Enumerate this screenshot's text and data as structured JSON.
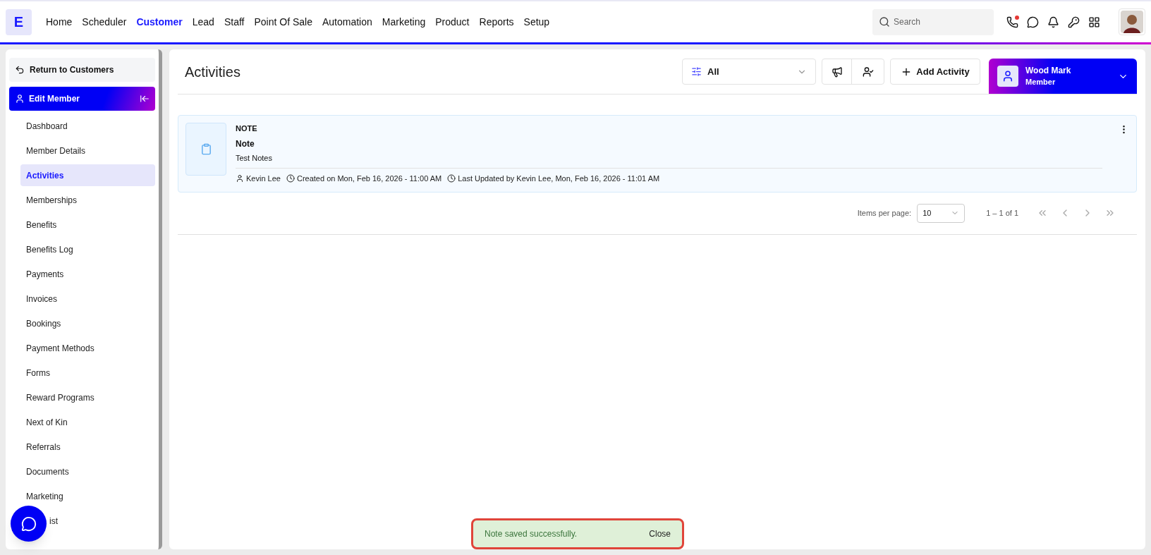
{
  "brand": {
    "letter": "E"
  },
  "nav": [
    {
      "label": "Home",
      "selected": false
    },
    {
      "label": "Scheduler",
      "selected": false
    },
    {
      "label": "Customer",
      "selected": true
    },
    {
      "label": "Lead",
      "selected": false
    },
    {
      "label": "Staff",
      "selected": false
    },
    {
      "label": "Point Of Sale",
      "selected": false
    },
    {
      "label": "Automation",
      "selected": false
    },
    {
      "label": "Marketing",
      "selected": false
    },
    {
      "label": "Product",
      "selected": false
    },
    {
      "label": "Reports",
      "selected": false
    },
    {
      "label": "Setup",
      "selected": false
    }
  ],
  "search": {
    "placeholder": "Search"
  },
  "sidebar": {
    "back": "Return to Customers",
    "section": "Edit Member",
    "items": [
      {
        "label": "Dashboard",
        "selected": false
      },
      {
        "label": "Member Details",
        "selected": false
      },
      {
        "label": "Activities",
        "selected": true
      },
      {
        "label": "Memberships",
        "selected": false
      },
      {
        "label": "Benefits",
        "selected": false
      },
      {
        "label": "Benefits Log",
        "selected": false
      },
      {
        "label": "Payments",
        "selected": false
      },
      {
        "label": "Invoices",
        "selected": false
      },
      {
        "label": "Bookings",
        "selected": false
      },
      {
        "label": "Payment Methods",
        "selected": false
      },
      {
        "label": "Forms",
        "selected": false
      },
      {
        "label": "Reward Programs",
        "selected": false
      },
      {
        "label": "Next of Kin",
        "selected": false
      },
      {
        "label": "Referrals",
        "selected": false
      },
      {
        "label": "Documents",
        "selected": false
      },
      {
        "label": "Marketing",
        "selected": false
      },
      {
        "label": "ist",
        "selected": false
      }
    ]
  },
  "page": {
    "title": "Activities",
    "filter": "All",
    "add_button": "Add Activity",
    "member": {
      "name": "Wood Mark",
      "role": "Member"
    }
  },
  "activities": [
    {
      "type": "NOTE",
      "title": "Note",
      "body": "Test Notes",
      "author": "Kevin Lee",
      "created": "Created on Mon, Feb 16, 2026 - 11:00 AM",
      "updated": "Last Updated by Kevin Lee, Mon, Feb 16, 2026 - 11:01 AM"
    }
  ],
  "pagination": {
    "label": "Items per page:",
    "page_size": "10",
    "range": "1 – 1 of 1"
  },
  "toast": {
    "message": "Note saved successfully.",
    "action": "Close"
  }
}
